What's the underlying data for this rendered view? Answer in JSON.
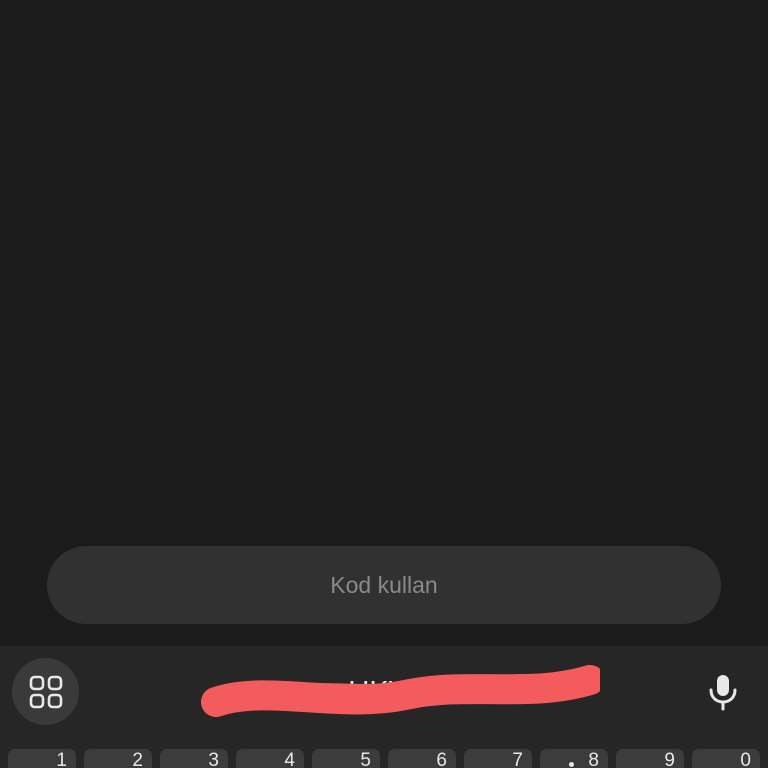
{
  "code_input": {
    "placeholder": "Kod kullan",
    "value": ""
  },
  "keyboard": {
    "apps_icon": "grid-apps-icon",
    "mic_icon": "microphone-icon",
    "suggestion": "…UKVR7K6",
    "suggestion_redacted": true,
    "number_keys": [
      "1",
      "2",
      "3",
      "4",
      "5",
      "6",
      "7",
      "8",
      "9",
      "0"
    ]
  },
  "colors": {
    "background": "#1b1b1b",
    "input_background": "#313131",
    "keyboard_background": "#262626",
    "key_background": "#3c3c3c",
    "redaction": "#f45b5d"
  }
}
